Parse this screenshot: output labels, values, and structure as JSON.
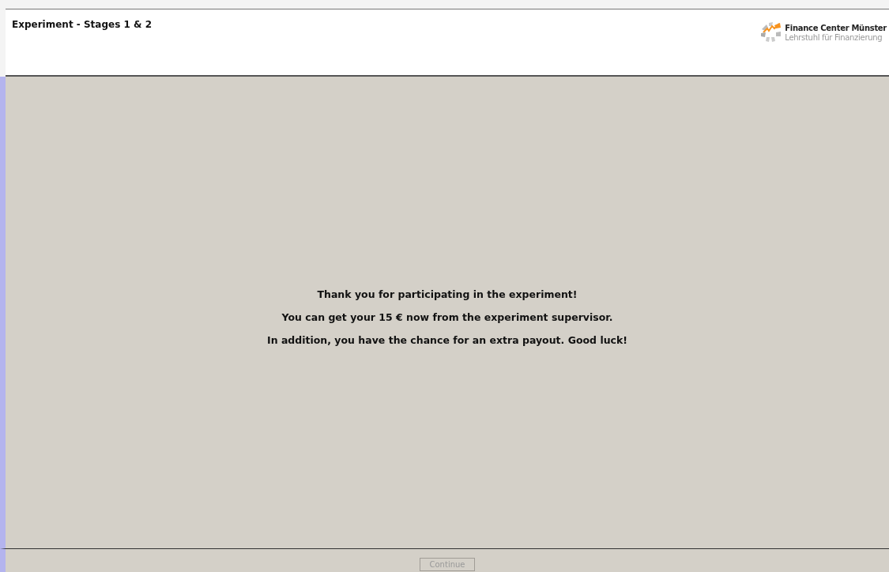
{
  "header": {
    "title": "Experiment - Stages 1 & 2",
    "logo": {
      "name": "Finance Center Münster",
      "subtitle": "Lehrstuhl für Finanzierung"
    }
  },
  "messages": [
    "Thank you for participating in the experiment!",
    "You can get your 15 € now from the experiment supervisor.",
    "In addition, you have the chance for an extra payout. Good luck!"
  ],
  "footer": {
    "button": {
      "label": "Continue",
      "disabled": true
    }
  }
}
